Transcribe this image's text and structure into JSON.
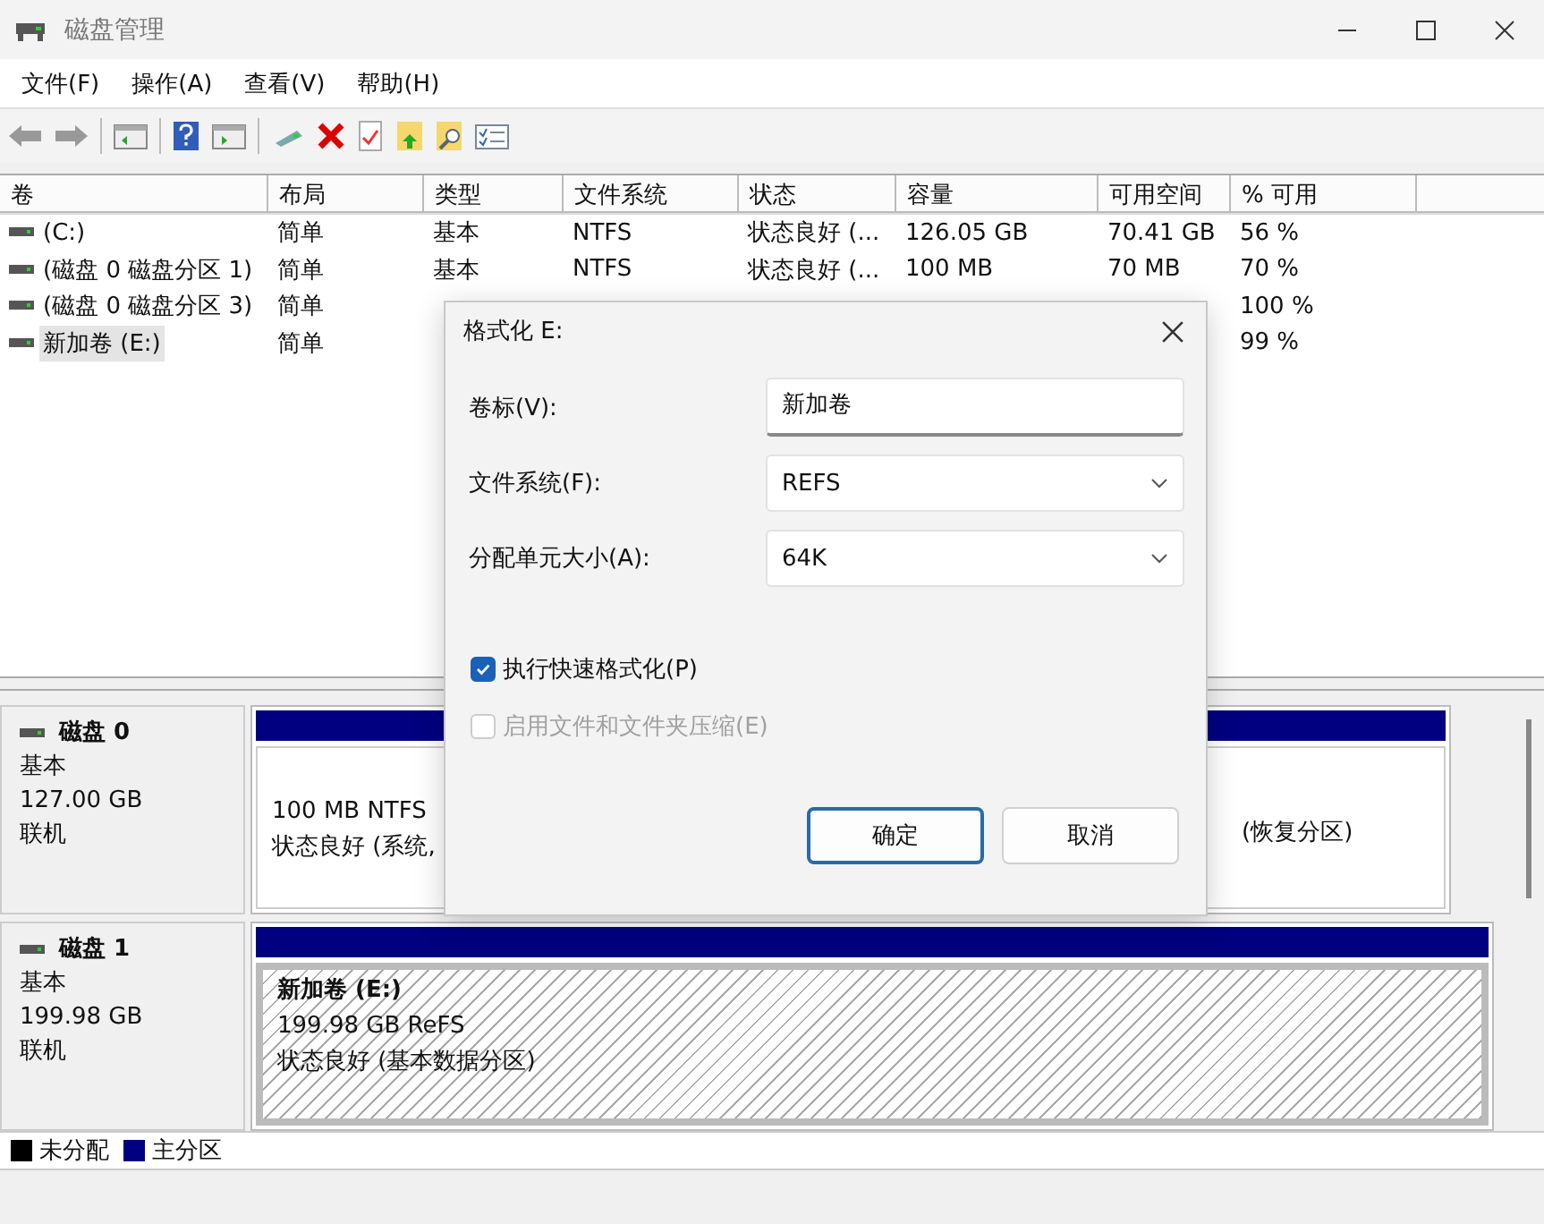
{
  "window": {
    "title": "磁盘管理"
  },
  "menu": [
    "文件(F)",
    "操作(A)",
    "查看(V)",
    "帮助(H)"
  ],
  "volume_list": {
    "columns": [
      "卷",
      "布局",
      "类型",
      "文件系统",
      "状态",
      "容量",
      "可用空间",
      "% 可用"
    ],
    "rows": [
      {
        "selected": false,
        "cells": [
          "(C:)",
          "简单",
          "基本",
          "NTFS",
          "状态良好 (...",
          "126.05 GB",
          "70.41 GB",
          "56 %"
        ]
      },
      {
        "selected": false,
        "cells": [
          "(磁盘 0 磁盘分区 1)",
          "简单",
          "基本",
          "NTFS",
          "状态良好 (...",
          "100 MB",
          "70 MB",
          "70 %"
        ]
      },
      {
        "selected": false,
        "cells": [
          "(磁盘 0 磁盘分区 3)",
          "简单",
          null,
          null,
          null,
          null,
          null,
          "100 %"
        ]
      },
      {
        "selected": true,
        "cells": [
          "新加卷 (E:)",
          "简单",
          null,
          null,
          null,
          null,
          null,
          "99 %"
        ]
      }
    ]
  },
  "disks": [
    {
      "name": "磁盘 0",
      "type": "基本",
      "size": "127.00 GB",
      "status": "联机",
      "partitions": [
        {
          "selected": false,
          "lines": [
            "100 MB NTFS",
            "状态良好 (系统,"
          ]
        },
        {
          "selected": false,
          "lines": [
            "(恢复分区)"
          ]
        }
      ]
    },
    {
      "name": "磁盘 1",
      "type": "基本",
      "size": "199.98 GB",
      "status": "联机",
      "partitions": [
        {
          "selected": true,
          "title": "新加卷  (E:)",
          "lines": [
            "199.98 GB ReFS",
            "状态良好 (基本数据分区)"
          ]
        }
      ]
    }
  ],
  "legend": [
    {
      "label": "未分配",
      "color": "#000000"
    },
    {
      "label": "主分区",
      "color": "#000080"
    }
  ],
  "dialog": {
    "title": "格式化 E:",
    "fields": [
      {
        "kind": "text",
        "label": "卷标(V):",
        "value": "新加卷"
      },
      {
        "kind": "dropdown",
        "label": "文件系统(F):",
        "value": "REFS"
      },
      {
        "kind": "dropdown",
        "label": "分配单元大小(A):",
        "value": "64K"
      }
    ],
    "options": [
      {
        "label": "执行快速格式化(P)",
        "checked": true,
        "disabled": false
      },
      {
        "label": "启用文件和文件夹压缩(E)",
        "checked": false,
        "disabled": true
      }
    ],
    "buttons": [
      {
        "label": "确定",
        "default": true
      },
      {
        "label": "取消",
        "default": false
      }
    ]
  }
}
